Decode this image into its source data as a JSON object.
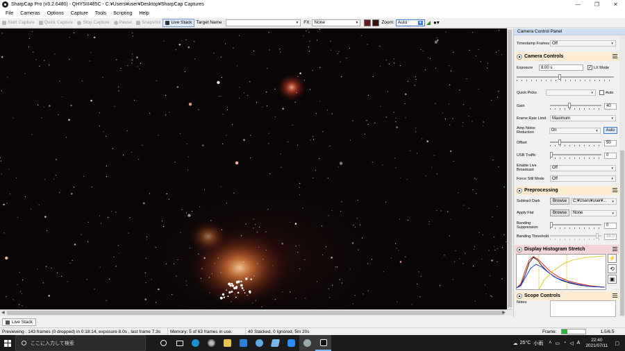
{
  "window": {
    "title": "SharpCap Pro (v3.2.6480) - QHY5III485C - C:¥Users¥user¥Desktop¥SharpCap Captures",
    "controls": [
      "—",
      "❐",
      "✕"
    ]
  },
  "menu": [
    "File",
    "Cameras",
    "Options",
    "Capture",
    "Tools",
    "Scripting",
    "Help"
  ],
  "toolbar": {
    "start_capture": "Start Capture",
    "quick_capture": "Quick Capture",
    "stop_capture": "Stop Capture",
    "pause": "Pause",
    "snapshot": "Snapshot",
    "live_stack": "Live Stack",
    "target_name_label": "Target Name :",
    "target_name_value": "",
    "fx_label": "FX:",
    "fx_value": "None",
    "zoom_label": "Zoom:",
    "zoom_value": "Auto"
  },
  "panel": {
    "title": "Camera Control Panel",
    "timestamp_frames_label": "Timestamp Frames",
    "timestamp_frames_value": "Off",
    "camera_controls": "Camera Controls",
    "exposure_label": "Exposure",
    "exposure_value": "8.00 s",
    "lx_mode_label": "LX Mode",
    "lx_mode_checked": true,
    "quick_picks_label": "Quick Picks",
    "quick_picks_value": "",
    "auto_label": "Auto",
    "gain_label": "Gain",
    "gain_value": "40",
    "frame_rate_limit_label": "Frame Rate Limit",
    "frame_rate_limit_value": "Maximum",
    "amp_noise_label": "Amp Noise Reduction",
    "amp_noise_value": "On",
    "amp_noise_auto": "Auto",
    "offset_label": "Offset",
    "offset_value": "50",
    "usb_traffic_label": "USB Traffic",
    "usb_traffic_value": "0",
    "enable_live_broadcast_label": "Enable Live Broadcast",
    "enable_live_broadcast_value": "Off",
    "force_still_mode_label": "Force Still Mode",
    "force_still_mode_value": "Off",
    "preprocessing": "Preprocessing",
    "subtract_dark_label": "Subtract Dark",
    "browse_label": "Browse",
    "subtract_dark_value": "C:¥Users¥user¥...",
    "apply_flat_label": "Apply Flat",
    "apply_flat_value": "None",
    "banding_suppression_label": "Banding Suppression",
    "banding_suppression_value": "0",
    "banding_threshold_label": "Banding Threshold",
    "banding_threshold_value": "35.0",
    "display_histogram_stretch": "Display Histogram Stretch",
    "scope_controls": "Scope Controls",
    "notes_label": "Notes"
  },
  "live_stack_tab": "Live Stack",
  "status": {
    "previewing": "Previewing : 143 frames (0 dropped) in 0:18:14, exposure 8.0s , last frame 7.3s",
    "memory": "Memory: 5 of 63 frames in use.",
    "stacked": "40 Stacked, 0 Ignored, 5m 20s",
    "frame_label": "Frame:",
    "frame_progress": 0.25,
    "fps": "1.5/6.5"
  },
  "taskbar": {
    "search_placeholder": "ここに入力して検索",
    "weather_temp": "25°C",
    "weather_text": "小雨",
    "ime": "A",
    "time": "22:40",
    "date": "2021/07/11"
  },
  "colors": {
    "accent_blue": "#cfe0f5",
    "histogram_section": "#f6d5d8",
    "section_header": "#fcecd2",
    "frame_progress": "#22bb33"
  }
}
